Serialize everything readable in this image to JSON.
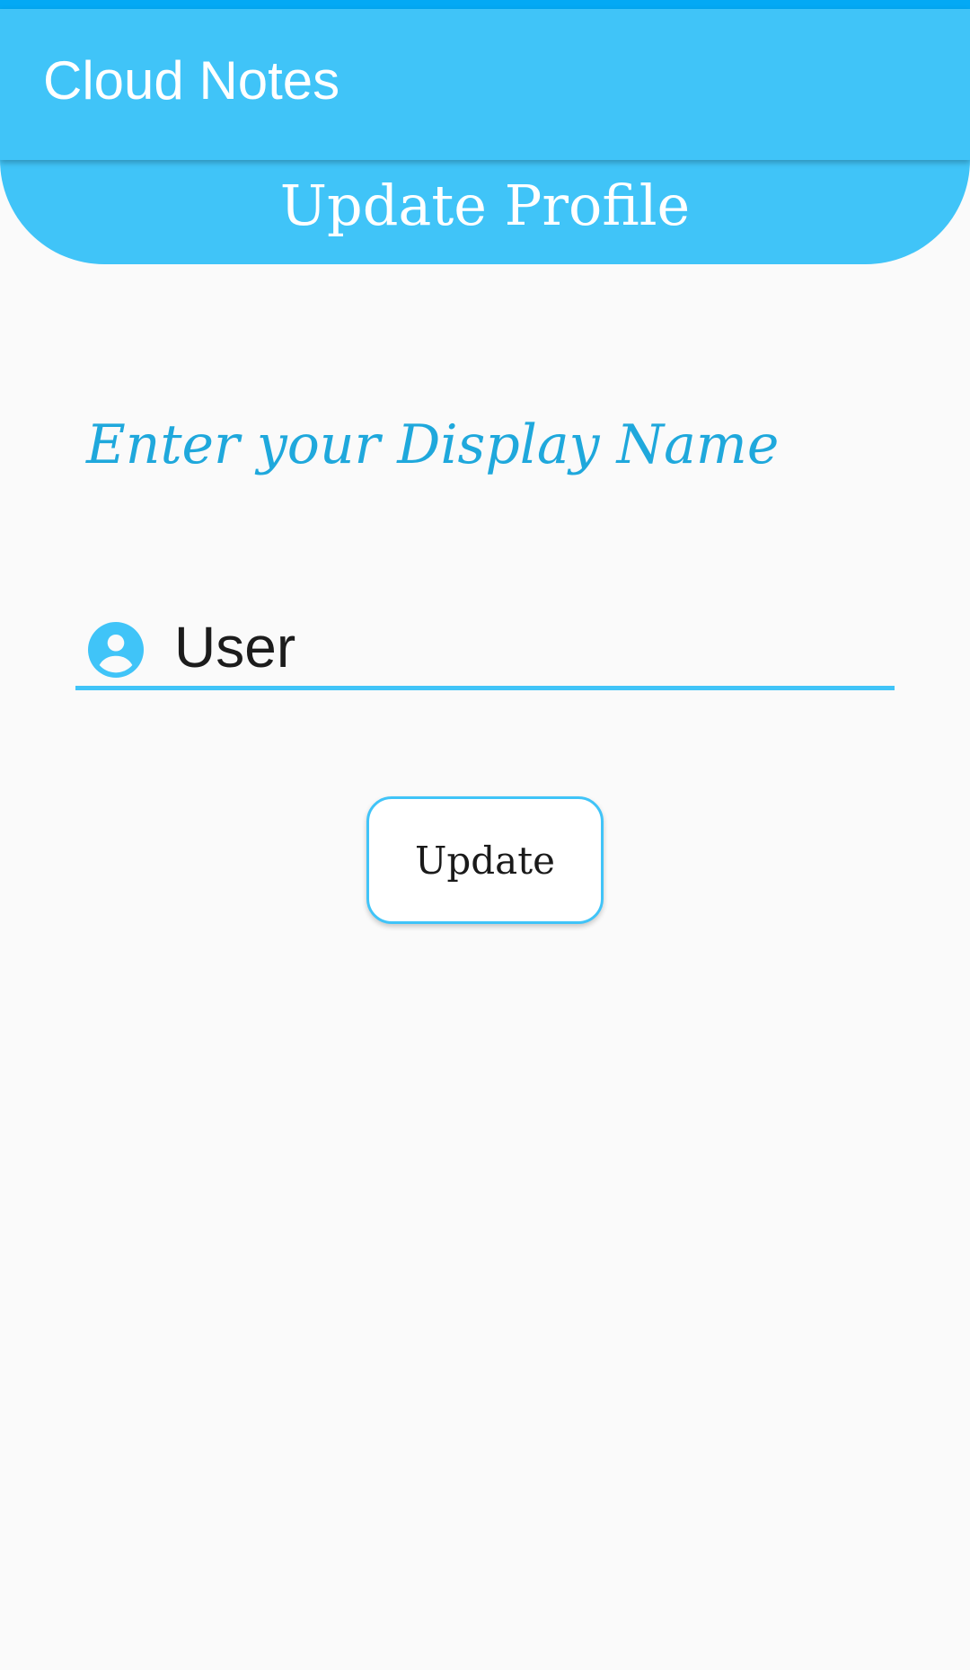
{
  "app_bar": {
    "title": "Cloud Notes"
  },
  "header": {
    "title": "Update Profile"
  },
  "form": {
    "prompt": "Enter your Display Name",
    "name_field": {
      "value": "User",
      "icon": "account-circle-icon"
    },
    "update_label": "Update"
  },
  "colors": {
    "primary": "#40c4f8",
    "status_bar": "#03a9f4",
    "prompt_text": "#1fa8dc",
    "background": "#fafafa"
  }
}
